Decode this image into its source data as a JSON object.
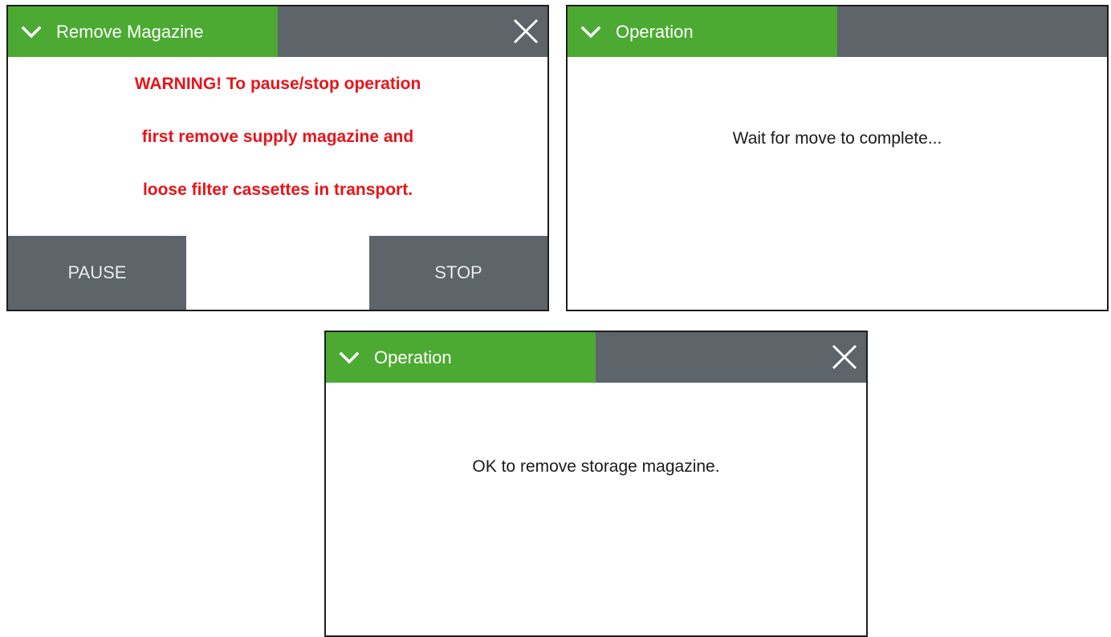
{
  "dialogs": [
    {
      "title": "Remove Magazine",
      "warning_lines": [
        "WARNING! To pause/stop operation",
        "first remove supply magazine and",
        "loose filter cassettes in transport."
      ],
      "buttons": {
        "pause": "PAUSE",
        "stop": "STOP"
      },
      "has_close": true
    },
    {
      "title": "Operation",
      "message": "Wait for move to complete...",
      "has_close": false
    },
    {
      "title": "Operation",
      "message": "OK to remove storage magazine.",
      "has_close": true
    }
  ],
  "icons": {
    "collapse": "chevron-down-icon",
    "close": "close-icon"
  },
  "colors": {
    "title_green": "#4caa33",
    "title_gray": "#5d646a",
    "warning_red": "#e8141a",
    "button_gray": "#5d646a"
  }
}
